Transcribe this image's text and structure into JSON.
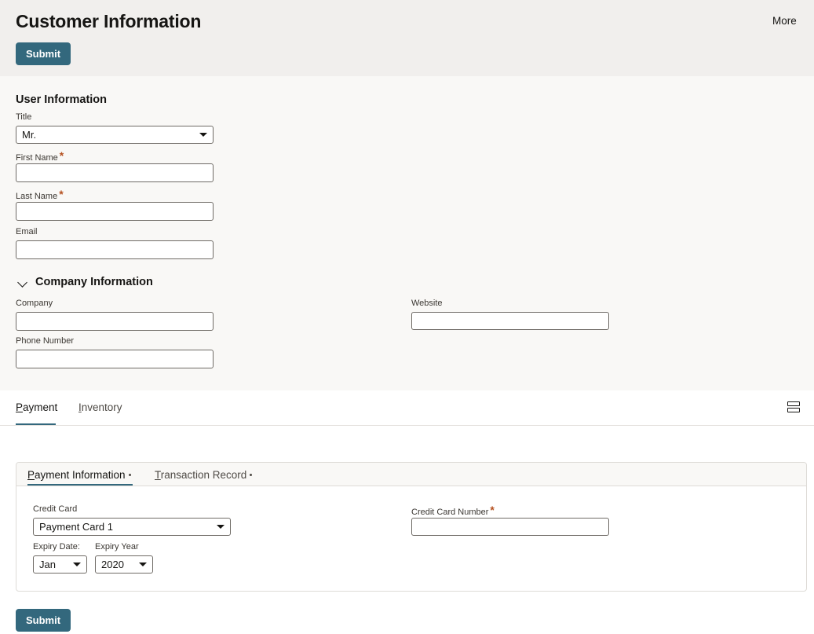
{
  "header": {
    "title": "Customer Information",
    "more_label": "More",
    "submit_label": "Submit"
  },
  "user_info": {
    "section_title": "User Information",
    "title_label": "Title",
    "title_value": "Mr.",
    "first_name_label": "First Name",
    "last_name_label": "Last Name",
    "email_label": "Email",
    "required_marker": "*"
  },
  "company_info": {
    "section_title": "Company Information",
    "company_label": "Company",
    "website_label": "Website",
    "phone_label": "Phone Number"
  },
  "tabs": {
    "payment": {
      "mnemonic": "P",
      "rest": "ayment"
    },
    "inventory": {
      "mnemonic": "I",
      "rest": "nventory"
    }
  },
  "payment_panel": {
    "subtabs": {
      "payment_information": {
        "mnemonic": "P",
        "rest": "ayment Information"
      },
      "transaction_record": {
        "mnemonic": "T",
        "rest": "ransaction Record"
      }
    },
    "credit_card_label": "Credit Card",
    "credit_card_value": "Payment Card 1",
    "credit_card_number_label": "Credit Card Number",
    "expiry_date_label": "Expiry Date:",
    "expiry_date_value": "Jan",
    "expiry_year_label": "Expiry Year",
    "expiry_year_value": "2020"
  },
  "footer": {
    "submit_label": "Submit"
  },
  "colors": {
    "accent": "#33687d",
    "required": "#b5501f",
    "header_bg": "#f1efed",
    "form_bg": "#f9f8f6"
  },
  "icons": {
    "layout": "layout-rows-icon",
    "collapse": "chevron-down-icon"
  }
}
